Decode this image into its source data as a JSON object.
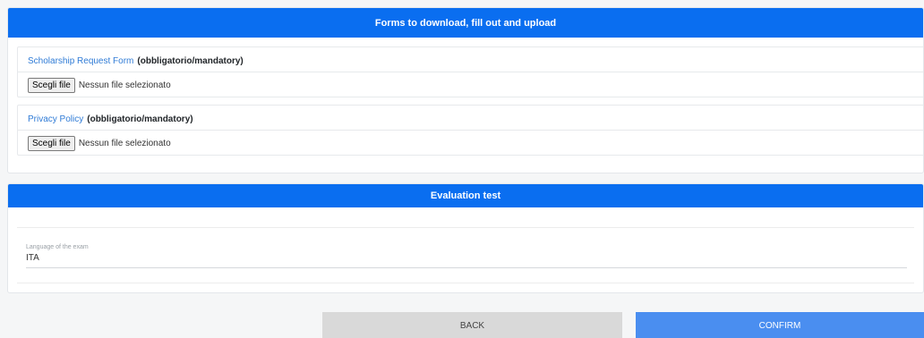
{
  "forms_section": {
    "header": "Forms to download, fill out and upload",
    "uploads": [
      {
        "link_text": "Scholarship Request Form",
        "required_text": "(obbligatorio/mandatory)",
        "button_label": "Scegli file",
        "status": "Nessun file selezionato"
      },
      {
        "link_text": "Privacy Policy",
        "required_text": "(obbligatorio/mandatory)",
        "button_label": "Scegli file",
        "status": "Nessun file selezionato"
      }
    ]
  },
  "evaluation_section": {
    "header": "Evaluation test",
    "language_field": {
      "label": "Language of the exam",
      "value": "ITA"
    }
  },
  "actions": {
    "back_label": "BACK",
    "confirm_label": "CONFIRM"
  },
  "colors": {
    "header_blue": "#0a6ef0",
    "link_blue": "#2f7bd6",
    "confirm_blue": "#4a8ef0",
    "back_gray": "#d9d9d9"
  }
}
